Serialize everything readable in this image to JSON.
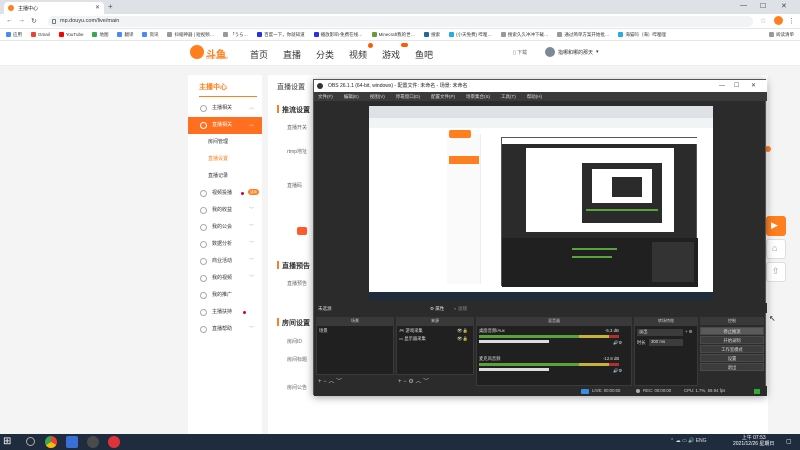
{
  "browser": {
    "tab_title": "主播中心",
    "url": "mp.douyu.com/live/main",
    "bookmarks": [
      "应用",
      "Gmail",
      "YouTube",
      "地图",
      "翻译",
      "资讯",
      "抖缩神器 | 短视频…",
      "「うら…",
      "百度一下，你就知道",
      "播放影响-免费在线…",
      "Minecraft我的世…",
      "搜索",
      "(小天免费) 哔哩…",
      "搜索久久冲冲下载…",
      "通过简单方案开始批…",
      "海猫吗（海）哔哩哩"
    ],
    "reading_list": "阅读清单"
  },
  "douyu": {
    "logo_text": "斗鱼",
    "logo_sub": "DOUYU.COM",
    "nav": [
      "首页",
      "直播",
      "分类",
      "视频",
      "游戏",
      "鱼吧"
    ],
    "download": "下载",
    "username": "指哪和哪的那天",
    "sidebar_title": "主播中心",
    "sidebar": [
      {
        "label": "主播相关",
        "type": "group"
      },
      {
        "label": "直播相关",
        "type": "active"
      },
      {
        "label": "房间管理",
        "type": "sub"
      },
      {
        "label": "直播设置",
        "type": "subact"
      },
      {
        "label": "直播记录",
        "type": "sub"
      },
      {
        "label": "视频投播",
        "type": "group",
        "badge": "活动"
      },
      {
        "label": "我的收益",
        "type": "group"
      },
      {
        "label": "我的公会",
        "type": "group"
      },
      {
        "label": "数据分析",
        "type": "group"
      },
      {
        "label": "商业活动",
        "type": "group"
      },
      {
        "label": "我的视频",
        "type": "group"
      },
      {
        "label": "我的推广",
        "type": "group"
      },
      {
        "label": "主播扶持",
        "type": "group"
      },
      {
        "label": "直播帮助",
        "type": "group"
      }
    ],
    "content": {
      "header": "直播设置",
      "section1": "推流设置",
      "row_labels": [
        "直播开关",
        "rtmp地址",
        "直播码"
      ],
      "section2": "直播预告",
      "preview_label": "直播预告",
      "section3": "房间设置",
      "room_labels": [
        "房间ID",
        "房间标题",
        "房间公告"
      ]
    }
  },
  "obs": {
    "title": "OBS 26.1.1 (64-bit, windows) - 配置文件: 未命名 - 场景: 未命名",
    "menu": [
      "文件(F)",
      "编辑(E)",
      "视图(V)",
      "停靠窗口(D)",
      "配置文件(P)",
      "场景集合(S)",
      "工具(T)",
      "帮助(H)"
    ],
    "no_source": "未选源",
    "props_btn": "属性",
    "filters_btn": "滤镜",
    "docks": {
      "scenes": "场景",
      "sources": "来源",
      "mixer": "混音器",
      "transitions": "转场特效",
      "controls": "控制"
    },
    "scene_item": "场景",
    "source_items": [
      "游戏采集",
      "显示器采集"
    ],
    "mixer_channels": [
      {
        "name": "桌面音频/Aux",
        "db": "-5.3 dB"
      },
      {
        "name": "麦克风音频",
        "db": "-12.8 dB"
      }
    ],
    "transition": {
      "type": "淡出",
      "duration_label": "时长",
      "duration": "300 ms"
    },
    "controls": [
      "停止推流",
      "开始录制",
      "工作室模式",
      "设置",
      "退出"
    ],
    "status": {
      "live": "LIVE: 00:00:00",
      "rec": "REC: 00:00:00",
      "cpu": "CPU: 1.7%, 59.94 fps"
    }
  },
  "taskbar": {
    "lang": "ENG",
    "time": "上午 07:53",
    "date": "2021/12/26 星期日"
  },
  "colors": {
    "douyu_orange": "#ff7e1d",
    "obs_bg": "#2b2b2b",
    "taskbar": "#1f2c3d"
  }
}
